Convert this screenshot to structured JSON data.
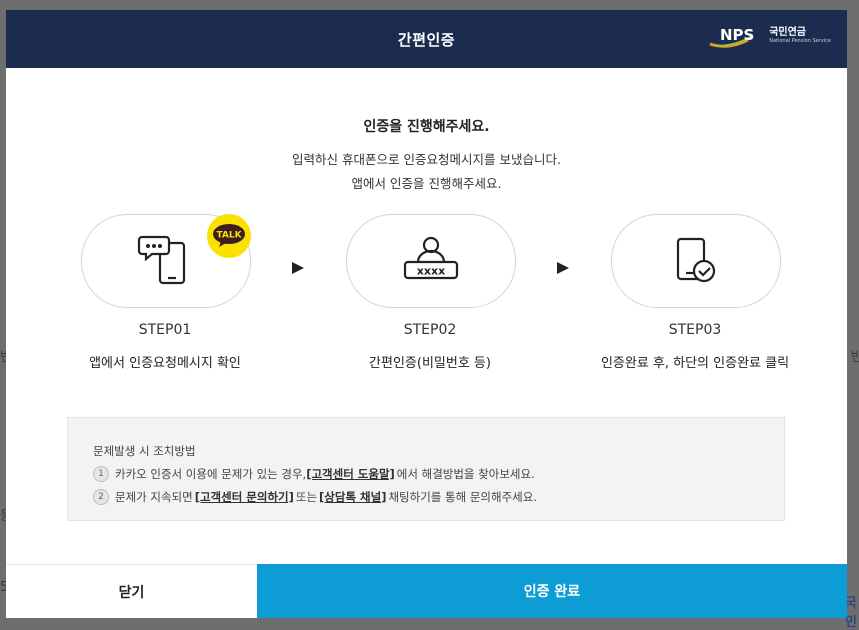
{
  "background": {
    "fragments": [
      "반",
      "반",
      "등",
      "5",
      "국민"
    ]
  },
  "header": {
    "title": "간편인증",
    "logo_mark": "NPS",
    "logo_ko": "국민연금",
    "logo_en": "National Pension Service"
  },
  "intro": {
    "title": "인증을 진행해주세요.",
    "desc_line1": "입력하신 휴대폰으로 인증요청메시지를 보냈습니다.",
    "desc_line2": "앱에서 인증을 진행해주세요."
  },
  "steps": [
    {
      "label": "STEP01",
      "desc": "앱에서 인증요청메시지 확인",
      "badge": "TALK",
      "icon": "phone-chat-icon"
    },
    {
      "label": "STEP02",
      "desc": "간편인증(비밀번호 등)",
      "icon": "password-user-icon"
    },
    {
      "label": "STEP03",
      "desc": "인증완료 후, 하단의 인증완료 클릭",
      "icon": "phone-check-icon"
    }
  ],
  "help": {
    "title": "문제발생 시 조치방법",
    "items": [
      {
        "num": "1",
        "pre": "카카오 인증서 이용에 문제가 있는 경우,",
        "link": "[고객센터 도움말]",
        "post": "에서 해결방법을 찾아보세요."
      },
      {
        "num": "2",
        "pre": "문제가 지속되면",
        "link1": "[고객센터 문의하기]",
        "mid": "또는",
        "link2": "[상담톡 채널]",
        "post": "채팅하기를 통해 문의해주세요."
      }
    ]
  },
  "footer": {
    "close_label": "닫기",
    "complete_label": "인증 완료"
  },
  "colors": {
    "header_bg": "#1b2c4f",
    "primary_button": "#0e9cd4",
    "kakao_yellow": "#fae100",
    "logo_orange": "#f7931e",
    "logo_green": "#8cc63f"
  }
}
